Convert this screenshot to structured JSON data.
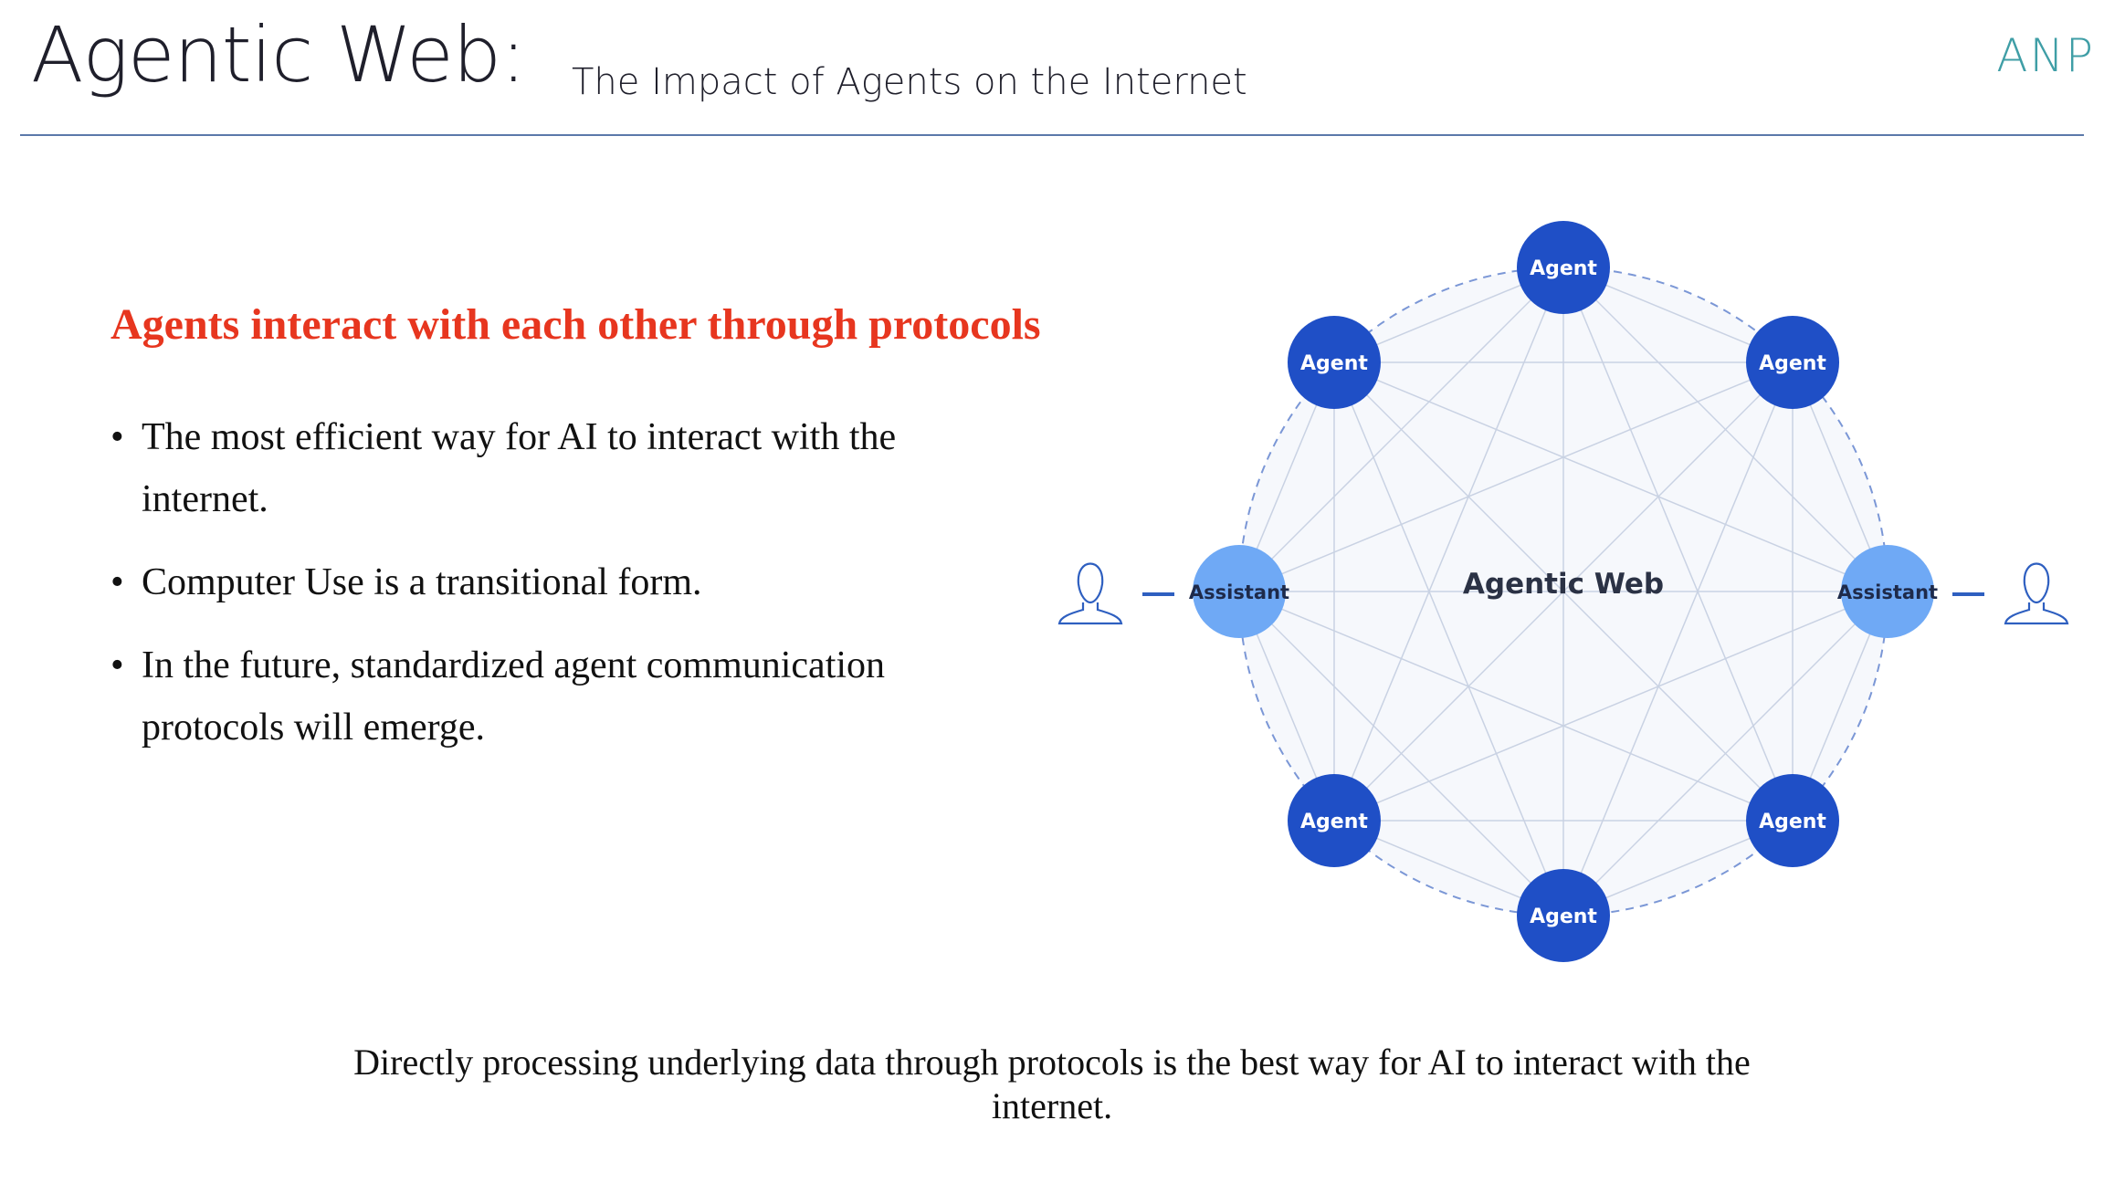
{
  "header": {
    "title": "Agentic Web:",
    "subtitle": "The Impact of Agents on the Internet",
    "logo": "ANP"
  },
  "left": {
    "heading": "Agents interact with each other through protocols",
    "bullets": [
      "The most efficient way for AI to interact with the internet.",
      "Computer Use is a transitional form.",
      "In the future, standardized agent communication protocols will emerge."
    ]
  },
  "diagram": {
    "center_label": "Agentic Web",
    "nodes": [
      {
        "label": "Agent",
        "kind": "agent"
      },
      {
        "label": "Agent",
        "kind": "agent"
      },
      {
        "label": "Assistant",
        "kind": "assistant"
      },
      {
        "label": "Agent",
        "kind": "agent"
      },
      {
        "label": "Agent",
        "kind": "agent"
      },
      {
        "label": "Agent",
        "kind": "agent"
      },
      {
        "label": "Assistant",
        "kind": "assistant"
      },
      {
        "label": "Agent",
        "kind": "agent"
      }
    ],
    "user_icons": [
      "user-icon",
      "user-icon"
    ],
    "colors": {
      "agent": "#1f4fc6",
      "assistant": "#6fa9f5",
      "ring": "#7b97d6",
      "mesh": "#c9d2e3",
      "fill": "#f6f8fc",
      "center_text": "#2b3245"
    }
  },
  "caption": "Directly processing underlying data through protocols is the best way for AI to interact with the internet."
}
